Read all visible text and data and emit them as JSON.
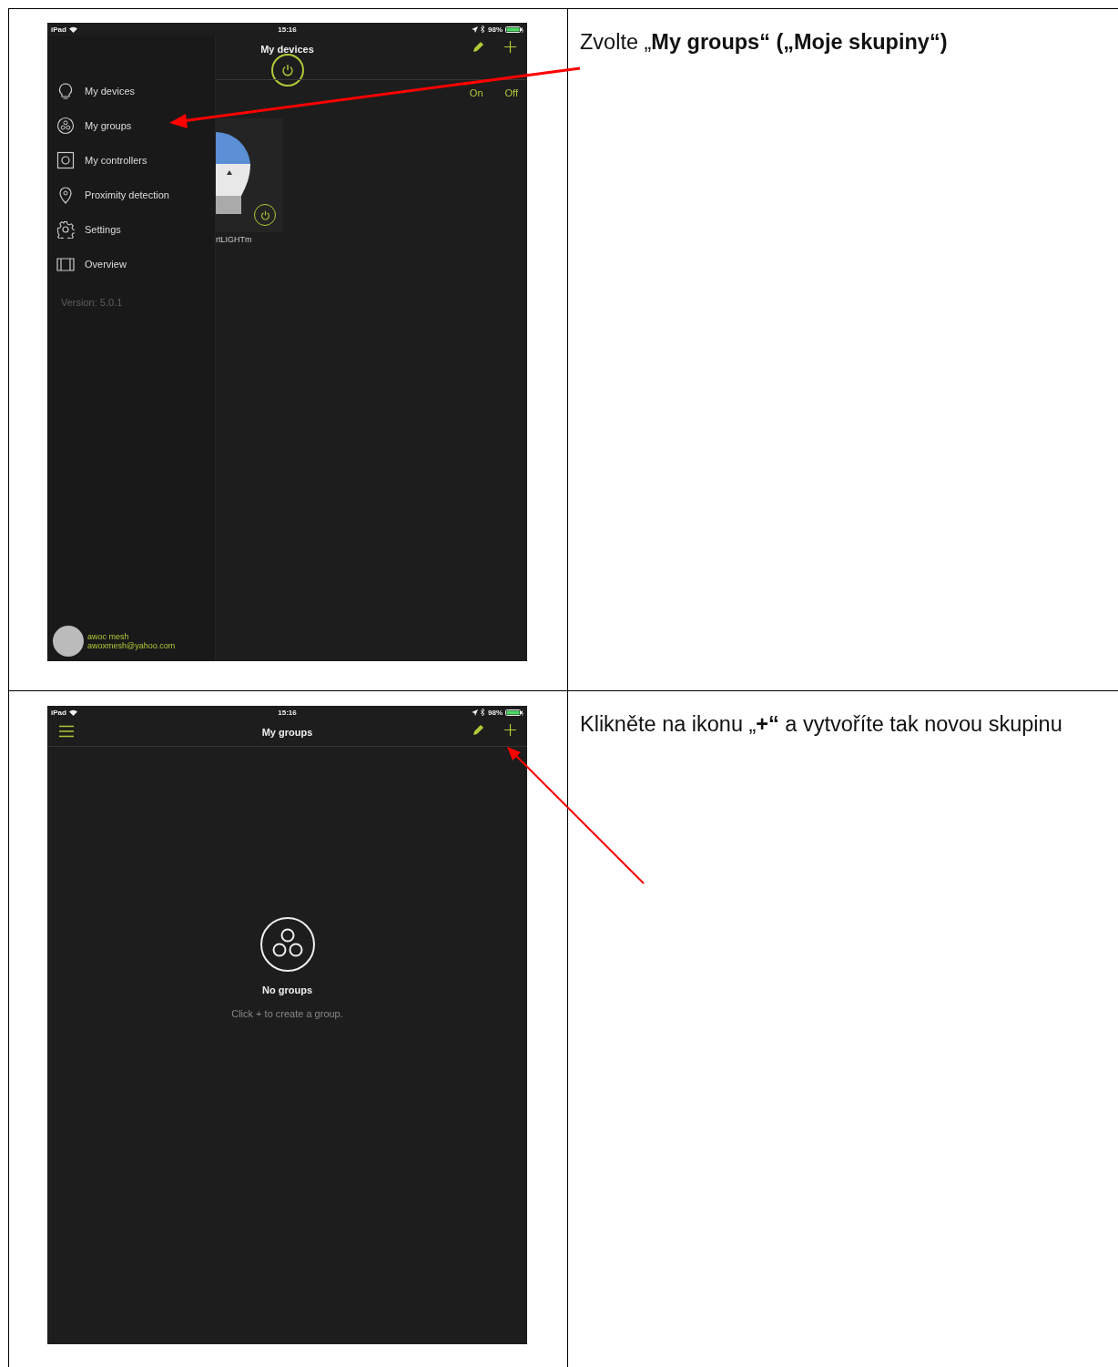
{
  "steps": [
    {
      "screen": {
        "kind": "drawer",
        "status_bar": {
          "device": "iPad",
          "time": "15:16",
          "battery": "98%"
        },
        "title": "My devices",
        "filters": [
          "On",
          "Off"
        ],
        "device_label": "rtLIGHTm",
        "menu": [
          {
            "kind": "bulb",
            "label": "My devices"
          },
          {
            "kind": "groups",
            "label": "My groups"
          },
          {
            "kind": "controller",
            "label": "My controllers"
          },
          {
            "kind": "pin",
            "label": "Proximity detection"
          },
          {
            "kind": "gear",
            "label": "Settings"
          },
          {
            "kind": "overview",
            "label": "Overview"
          }
        ],
        "version": "Version: 5.0.1",
        "user": {
          "name": "awoc mesh",
          "email": "awoxmesh@yahoo.com"
        }
      },
      "instruction": "Zvolte „**My groups“ („Moje skupiny“)**"
    },
    {
      "screen": {
        "kind": "empty",
        "status_bar": {
          "device": "iPad",
          "time": "15:16",
          "battery": "98%"
        },
        "title": "My groups",
        "empty_title": "No groups",
        "empty_hint": "Click + to create a group."
      },
      "instruction": "Klikněte na ikonu „**+“** a vytvoříte tak novou skupinu"
    }
  ]
}
